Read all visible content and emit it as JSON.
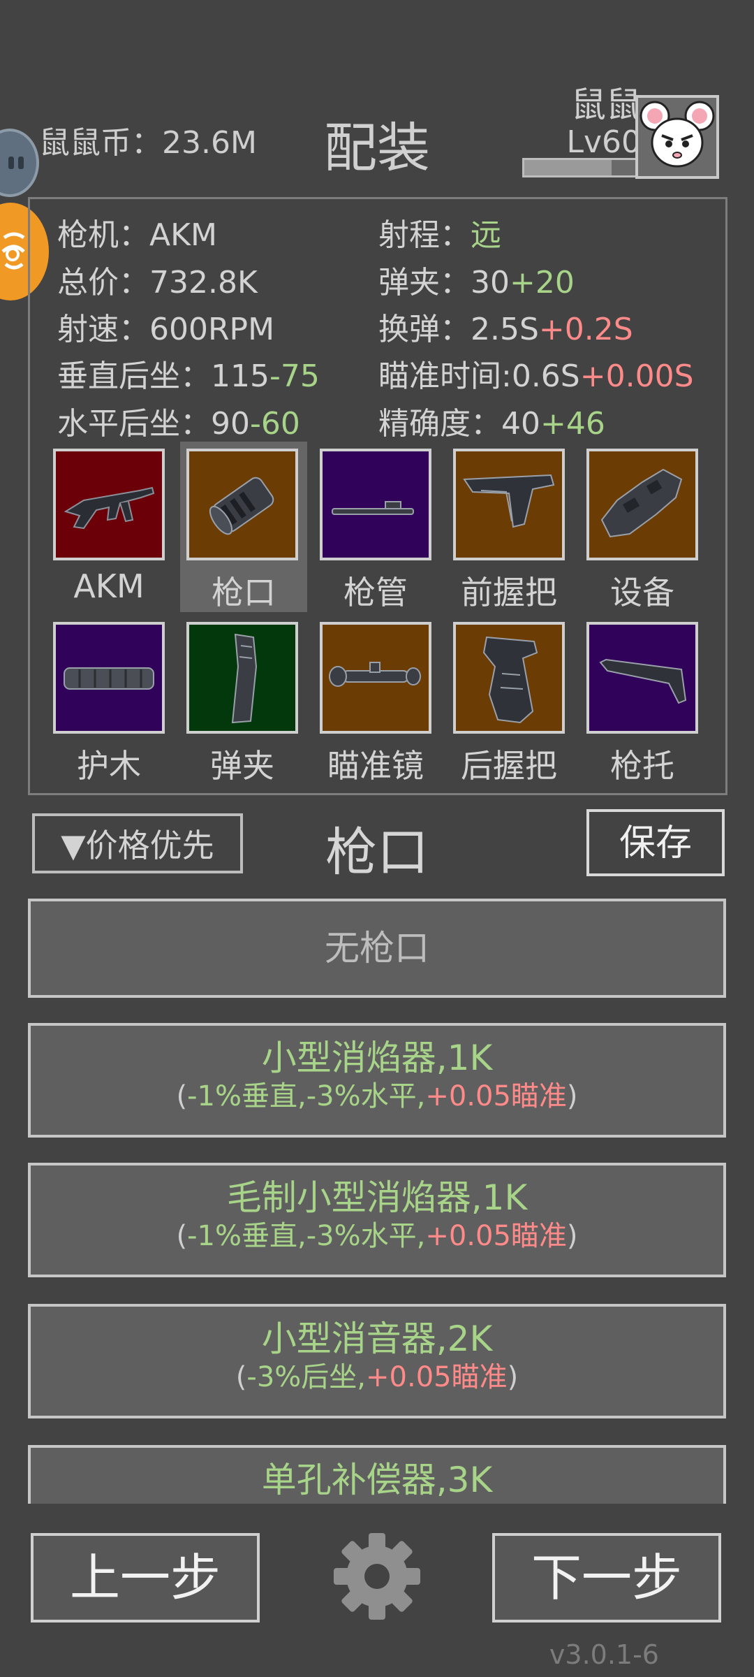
{
  "header": {
    "coin_label": "鼠鼠币：",
    "coin_value": "23.6M",
    "title": "配装",
    "player_name": "鼠鼠",
    "player_level": "Lv60",
    "xp_fraction": 0.78
  },
  "stats": {
    "gun_label": "枪机：",
    "gun_value": "AKM",
    "range_label": "射程：",
    "range_value": "远",
    "price_label": "总价：",
    "price_value": "732.8K",
    "mag_label": "弹夹：",
    "mag_value": "30",
    "mag_bonus": "+20",
    "rpm_label": "射速：",
    "rpm_value": "600RPM",
    "reload_label": "换弹：",
    "reload_value": "2.5S",
    "reload_bonus": "+0.2S",
    "vrec_label": "垂直后坐：",
    "vrec_value": "115",
    "vrec_bonus": "-75",
    "aim_label": "瞄准时间:",
    "aim_value": "0.6S",
    "aim_bonus": "+0.00S",
    "hrec_label": "水平后坐：",
    "hrec_value": "90",
    "hrec_bonus": "-60",
    "acc_label": "精确度：",
    "acc_value": "40",
    "acc_bonus": "+46"
  },
  "slots": [
    {
      "label": "AKM",
      "icon": "rifle-icon",
      "color": "#6b0008"
    },
    {
      "label": "枪口",
      "icon": "muzzle-icon",
      "color": "#6b3d05",
      "selected": true
    },
    {
      "label": "枪管",
      "icon": "barrel-icon",
      "color": "#30025a"
    },
    {
      "label": "前握把",
      "icon": "foregrip-icon",
      "color": "#6b3d05"
    },
    {
      "label": "设备",
      "icon": "device-icon",
      "color": "#6b3d05"
    },
    {
      "label": "护木",
      "icon": "handguard-icon",
      "color": "#30025a"
    },
    {
      "label": "弹夹",
      "icon": "magazine-icon",
      "color": "#03380c"
    },
    {
      "label": "瞄准镜",
      "icon": "scope-icon",
      "color": "#6b3d05"
    },
    {
      "label": "后握把",
      "icon": "pistol-grip-icon",
      "color": "#6b3d05"
    },
    {
      "label": "枪托",
      "icon": "stock-icon",
      "color": "#30025a"
    }
  ],
  "controls": {
    "sort_label": "▼价格优先",
    "section_title": "枪口",
    "save_label": "保存"
  },
  "options": [
    {
      "name": "无枪口"
    },
    {
      "name": "小型消焰器,1K",
      "d_open": "(",
      "d_g1": "-1%垂直,",
      "d_g2": "-3%水平,",
      "d_r": "+0.05瞄准",
      "d_close": ")"
    },
    {
      "name": "毛制小型消焰器,1K",
      "d_open": "(",
      "d_g1": "-1%垂直,",
      "d_g2": "-3%水平,",
      "d_r": "+0.05瞄准",
      "d_close": ")"
    },
    {
      "name": "小型消音器,2K",
      "d_open": "(",
      "d_g1": "-3%后坐,",
      "d_r": "+0.05瞄准",
      "d_close": ")"
    },
    {
      "name": "单孔补偿器,3K"
    }
  ],
  "footer": {
    "prev_label": "上一步",
    "next_label": "下一步",
    "version": "v3.0.1-6",
    "settings_icon": "gear-icon"
  }
}
